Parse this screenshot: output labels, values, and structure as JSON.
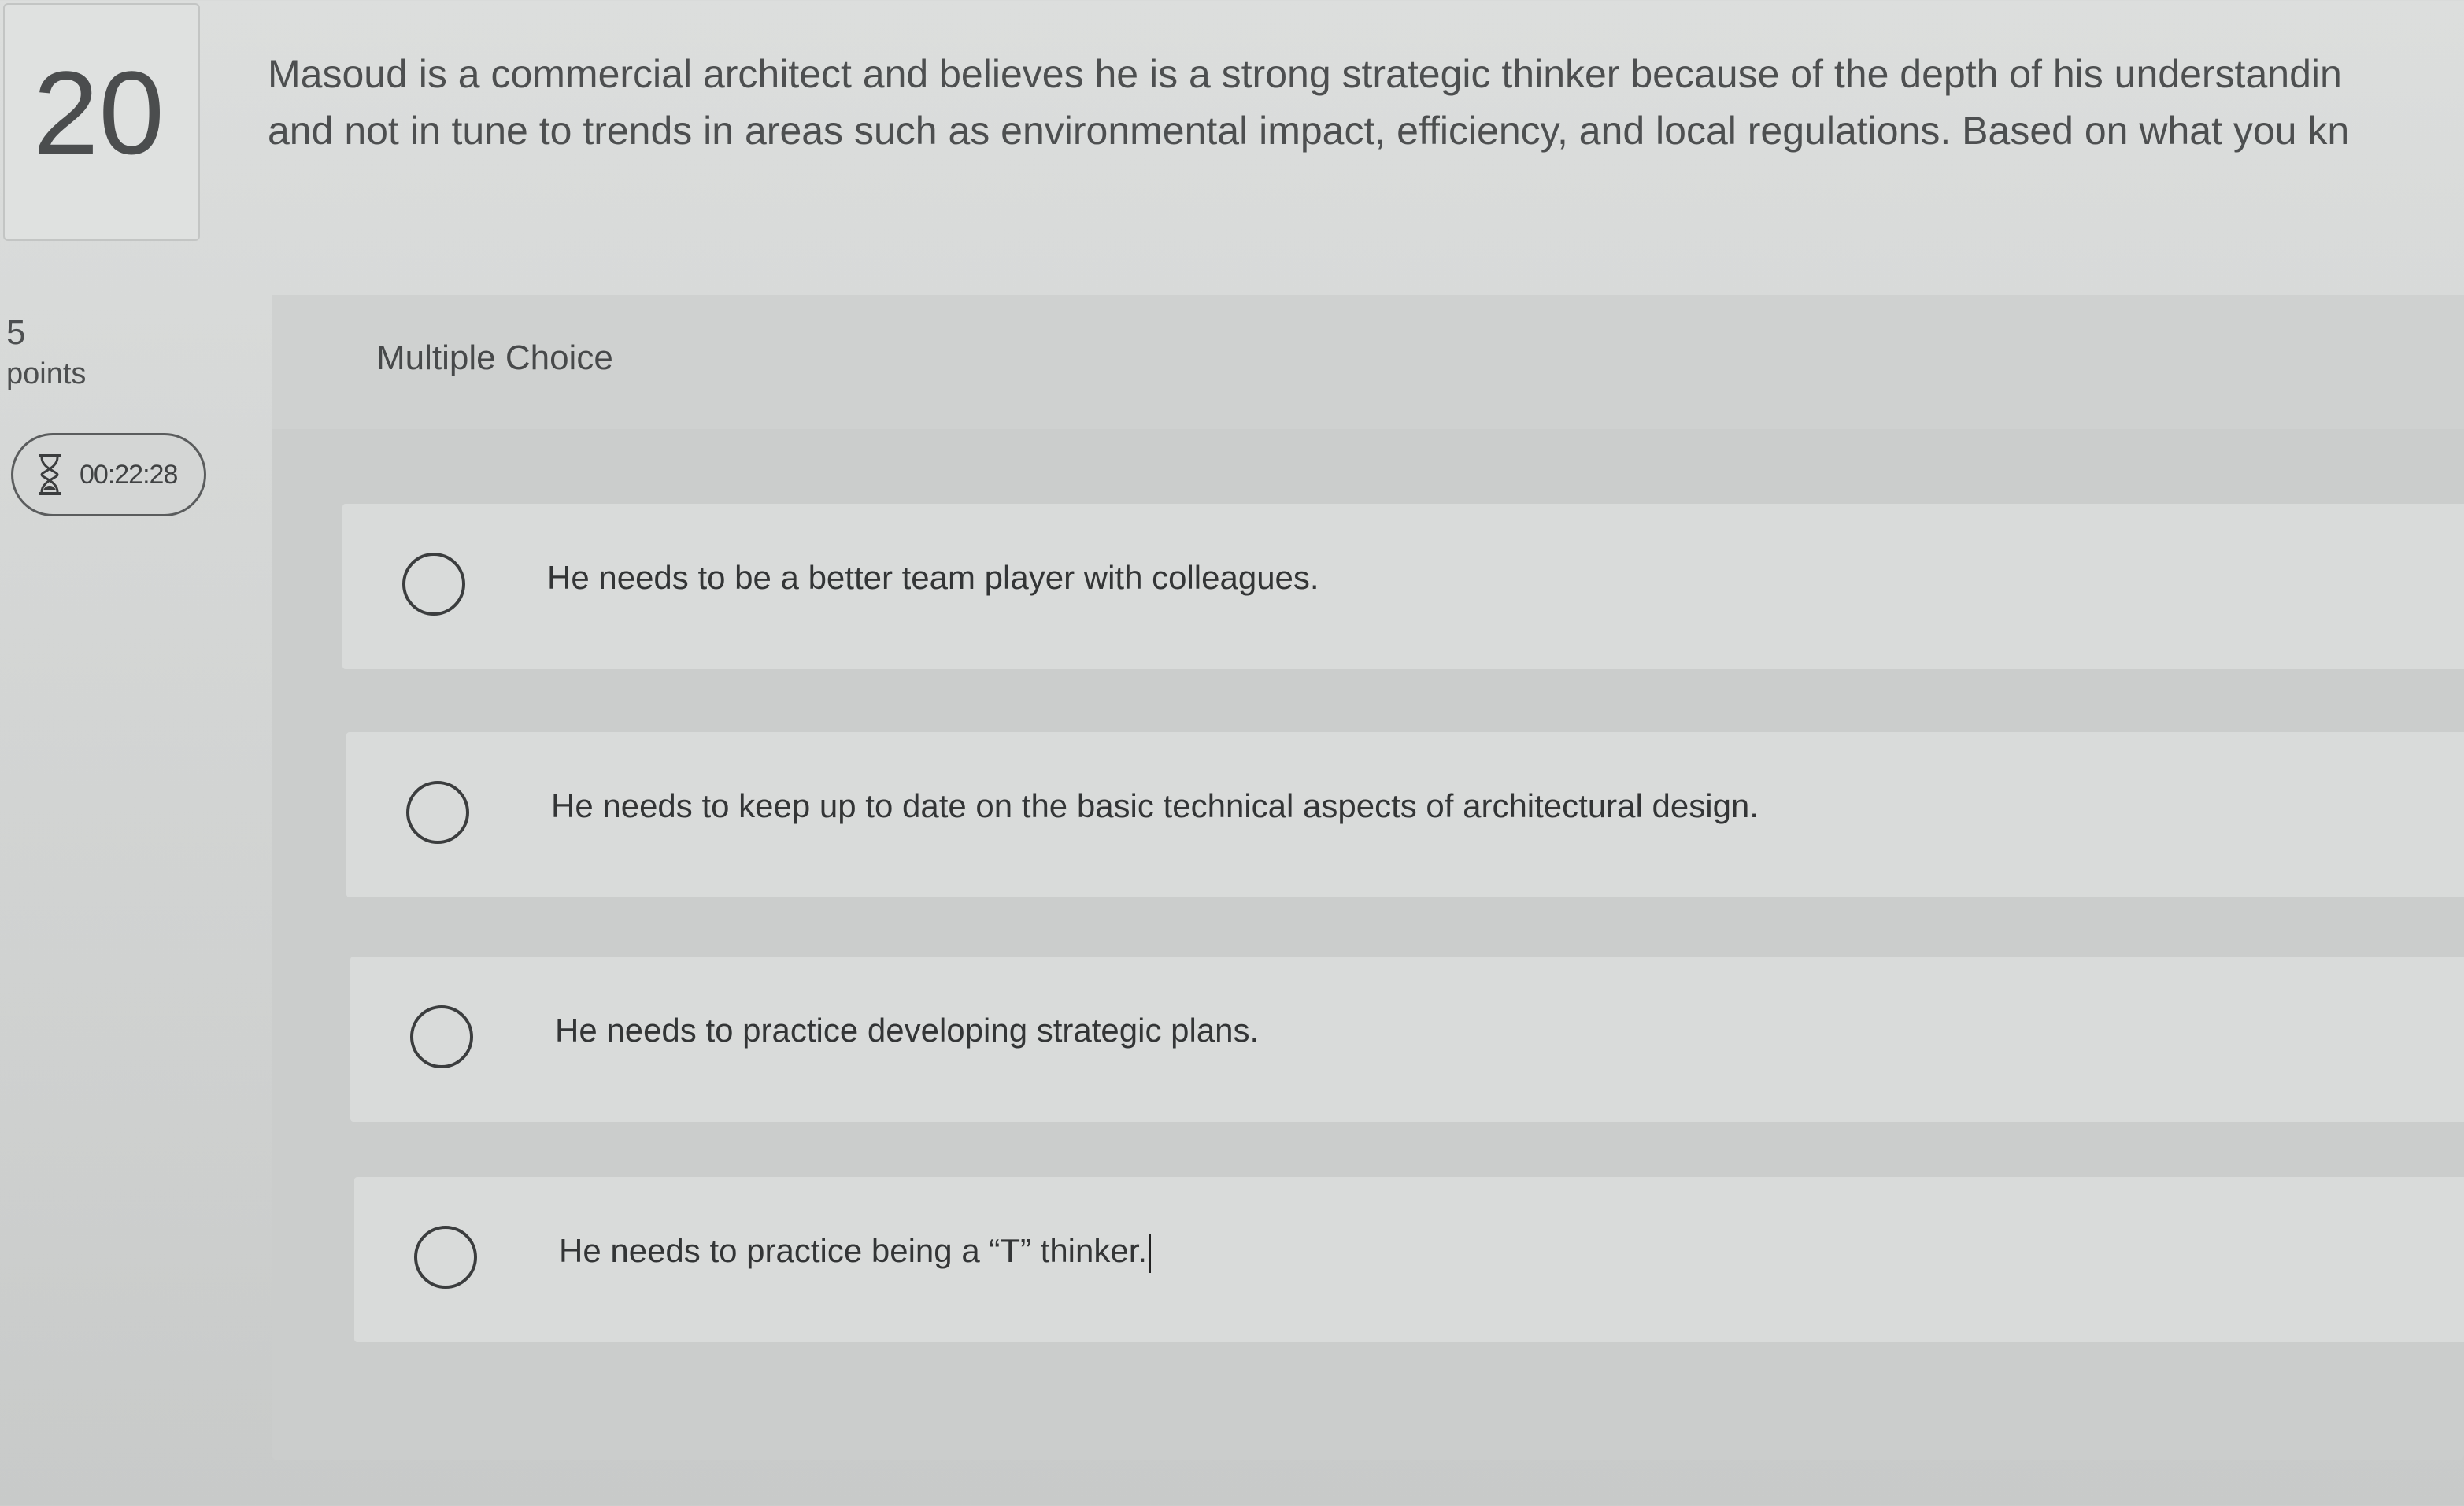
{
  "question": {
    "number": "20",
    "text_line_1": "Masoud is a commercial architect and believes he is a strong strategic thinker because of the depth of his understandin",
    "text_line_2": "and not in tune to trends in areas such as environmental impact, efficiency, and local regulations. Based on what you kn"
  },
  "meta": {
    "points_value": "5",
    "points_label": "points",
    "timer": "00:22:28",
    "timer_icon": "hourglass-icon"
  },
  "choices": {
    "type_label": "Multiple Choice",
    "options": [
      {
        "label": "He needs to be a better team player with colleagues."
      },
      {
        "label": "He needs to keep up to date on the basic technical aspects of architectural design."
      },
      {
        "label": "He needs to practice developing strategic plans."
      },
      {
        "label": "He needs to practice being a “T” thinker."
      }
    ]
  }
}
